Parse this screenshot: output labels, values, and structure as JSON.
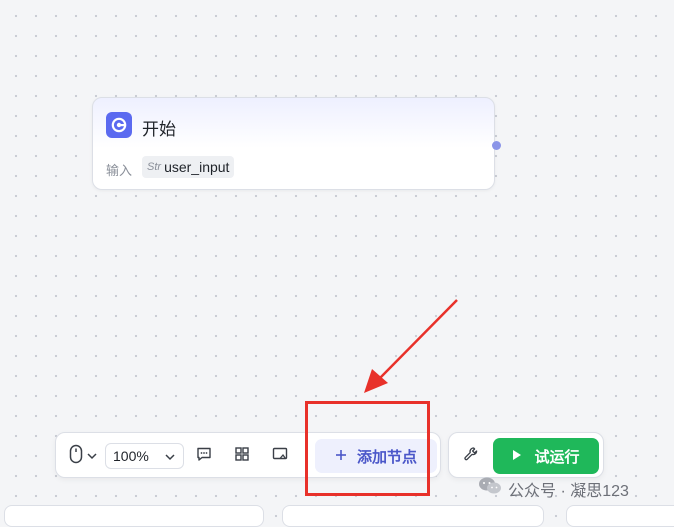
{
  "start_node": {
    "title": "开始",
    "input_label": "输入",
    "variable": {
      "type": "Str",
      "name": "user_input"
    }
  },
  "toolbar": {
    "zoom_value": "100%",
    "add_node_label": "添加节点",
    "icons": [
      "mouse-icon",
      "chevron-down-icon",
      "comment-icon",
      "grid-layout-icon",
      "minimap-icon",
      "plus-icon"
    ]
  },
  "run_bar": {
    "run_label": "试运行",
    "icons": [
      "wrench-icon",
      "play-icon"
    ]
  },
  "watermark": {
    "text": "公众号 · 凝思123"
  },
  "colors": {
    "accent": "#5b6af0",
    "run_green": "#1fb85a",
    "annotation_red": "#e8312a",
    "canvas": "#f4f5f7"
  }
}
